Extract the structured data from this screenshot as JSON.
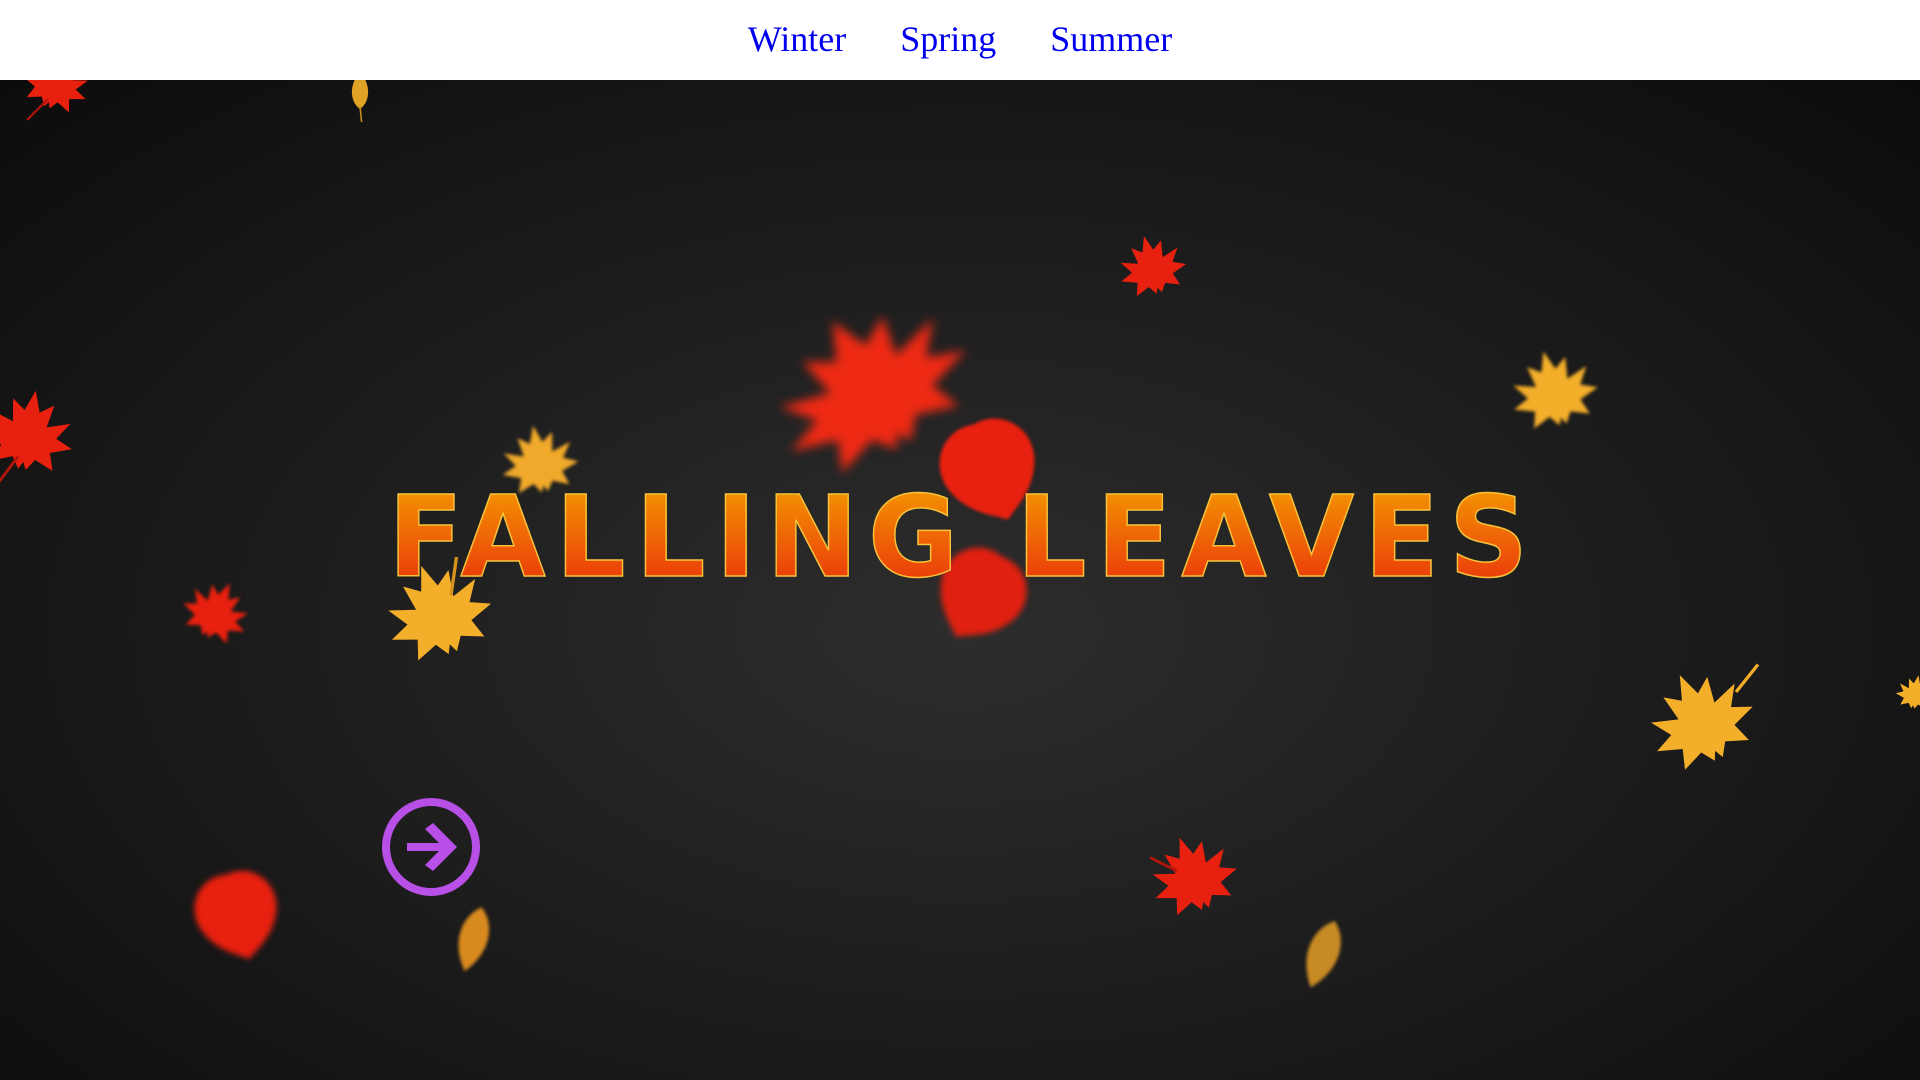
{
  "nav": {
    "links": [
      {
        "label": "Winter"
      },
      {
        "label": "Spring"
      },
      {
        "label": "Summer"
      }
    ],
    "link_color": "#0000ee"
  },
  "hero": {
    "title": "FALLING LEAVES",
    "gradient_top": "#f5a200",
    "gradient_bottom": "#e8270c"
  },
  "next_button": {
    "icon": "arrow-right-circle-icon",
    "color": "#b84fe6"
  },
  "colors": {
    "background": "#1e1e1e",
    "leaf_red": "#e8200f",
    "leaf_yellow": "#f3ae2a",
    "leaf_orange": "#d98a1e"
  }
}
